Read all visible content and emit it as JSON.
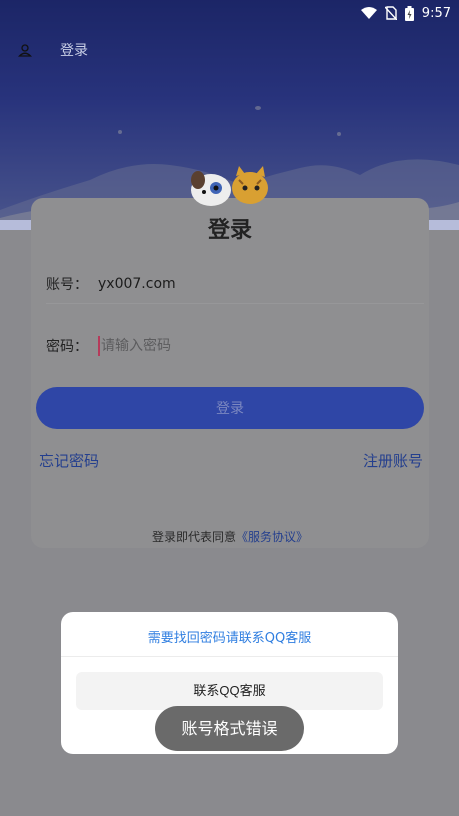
{
  "status_bar": {
    "time": "9:57",
    "icons": [
      "wifi-icon",
      "no-sim-icon",
      "battery-icon"
    ]
  },
  "app_bar": {
    "title": "登录",
    "icon": "user-icon"
  },
  "login_card": {
    "title": "登录",
    "account": {
      "label": "账号：",
      "value": "yx007.com"
    },
    "password": {
      "label": "密码：",
      "placeholder": "请输入密码",
      "value": ""
    },
    "login_button": "登录",
    "forgot_password": "忘记密码",
    "register": "注册账号",
    "agreement_prefix": "登录即代表同意",
    "agreement_link": "《服务协议》"
  },
  "dialog": {
    "message": "需要找回密码请联系QQ客服",
    "button": "联系QQ客服"
  },
  "toast": {
    "message": "账号格式错误"
  },
  "colors": {
    "accent": "#2f46a6",
    "link": "#2f7ee0",
    "hero_top": "#2b3a9e"
  }
}
